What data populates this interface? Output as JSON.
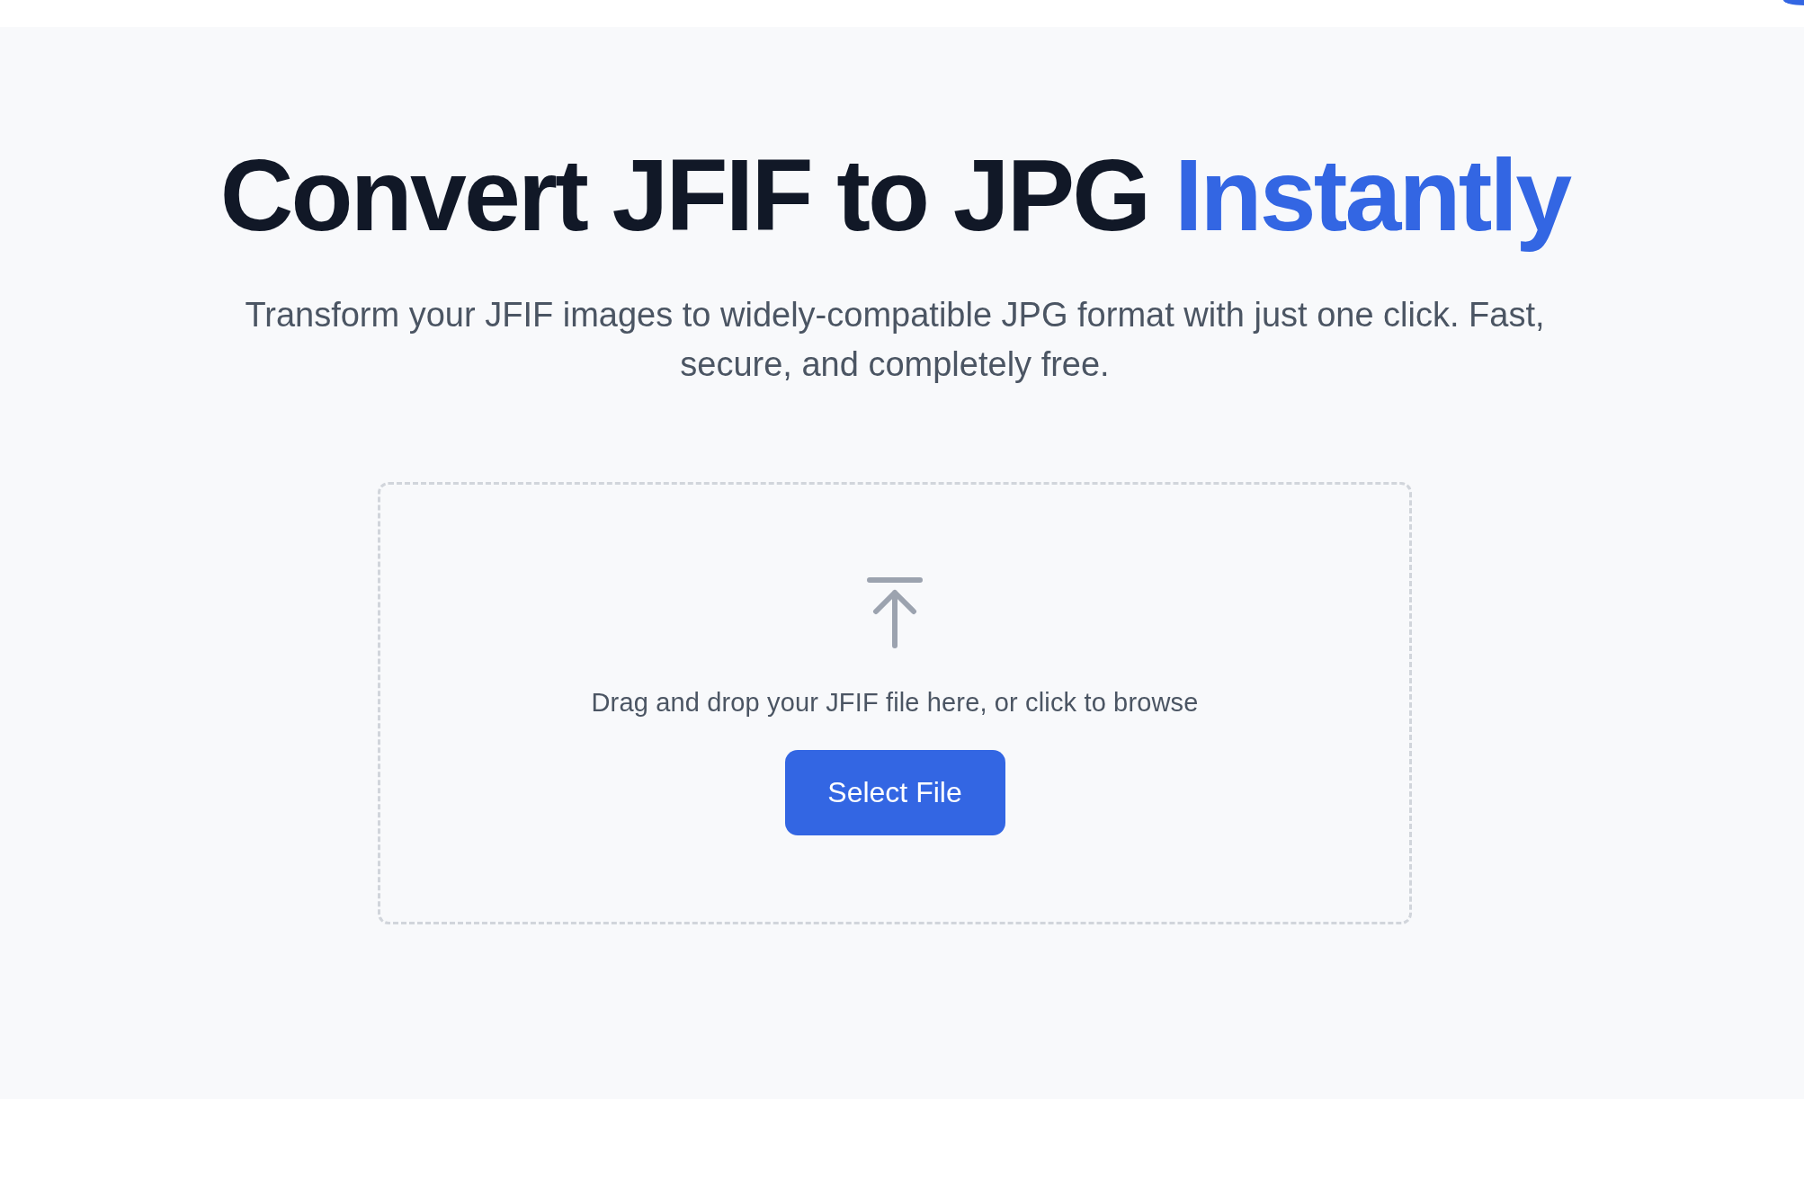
{
  "hero": {
    "title": "Convert JFIF to JPG",
    "title_highlight": "Instantly",
    "subtitle": "Transform your JFIF images to widely-compatible JPG format with just one click. Fast, secure, and completely free."
  },
  "upload": {
    "prompt": "Drag and drop your JFIF file here, or click to browse",
    "button": "Select File"
  }
}
